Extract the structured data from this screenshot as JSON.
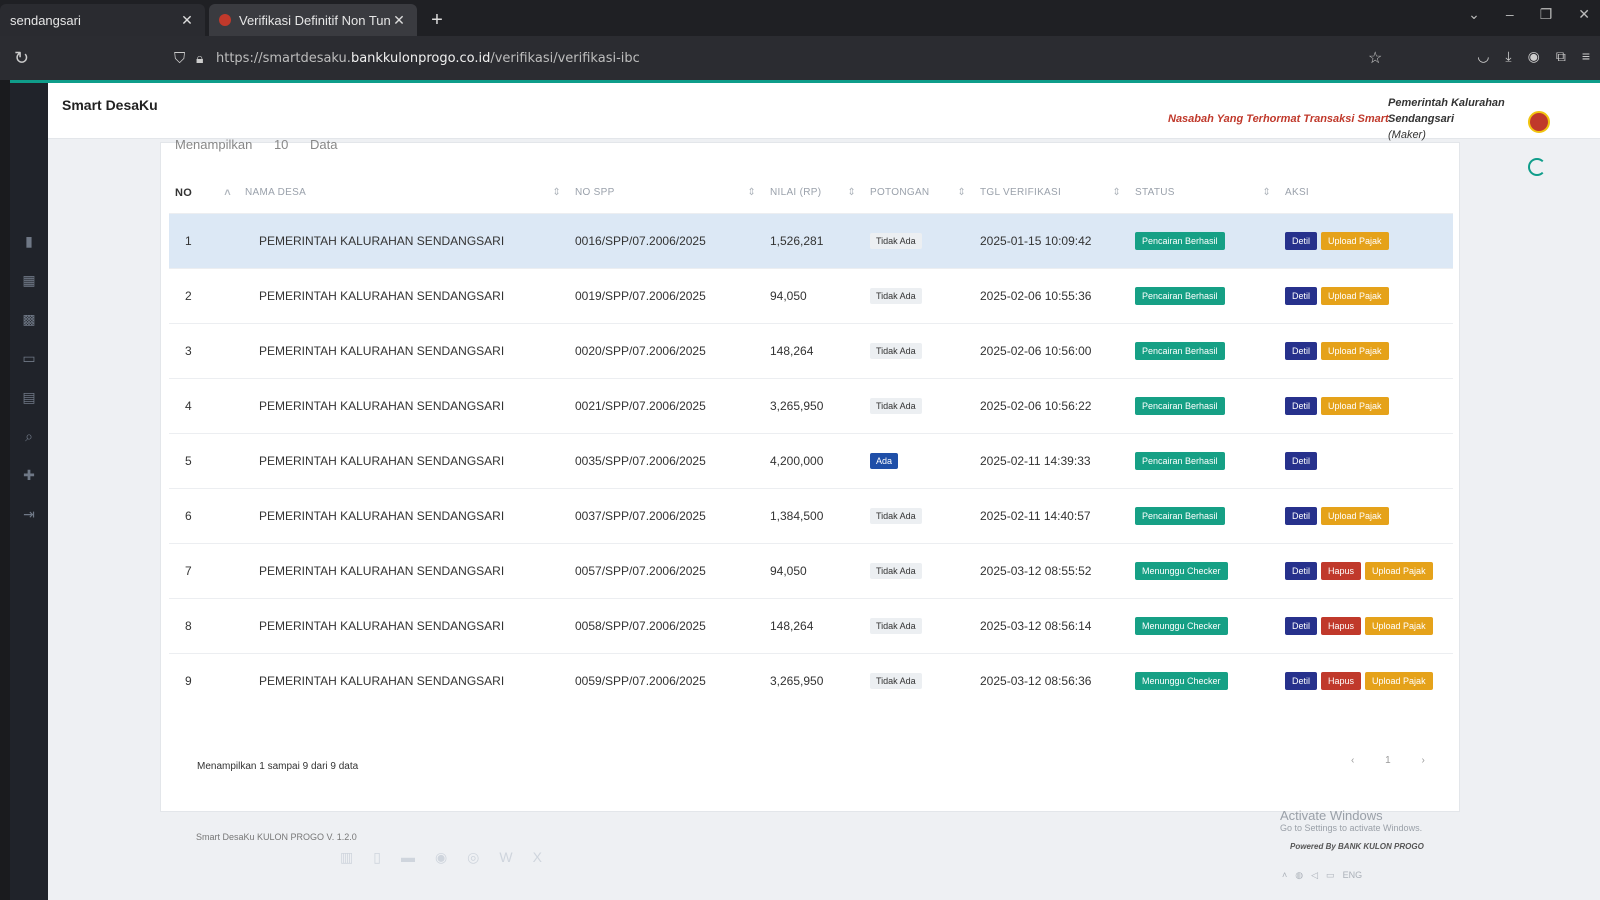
{
  "browser": {
    "tabs": [
      {
        "label": "sendangsari",
        "active": false
      },
      {
        "label": "Verifikasi Definitif Non Tunai - S",
        "active": true
      }
    ],
    "url_prefix": "https://smartdesaku.",
    "url_domain": "bankkulonprogo.co.id",
    "url_path": "/verifikasi/verifikasi-ibc"
  },
  "header": {
    "brand": "Smart DesaKu",
    "marquee": "Nasabah Yang Terhormat Transaksi Smart",
    "user_name_line1": "Pemerintah Kalurahan",
    "user_name_line2": "Sendangsari",
    "user_role": "(Maker)"
  },
  "table": {
    "top_label": "Menampilkan",
    "top_count": "10",
    "top_suffix": "Data",
    "columns": [
      "NO",
      "NAMA DESA",
      "NO SPP",
      "NILAI (RP)",
      "POTONGAN",
      "TGL VERIFIKASI",
      "STATUS",
      "AKSI"
    ],
    "rows": [
      {
        "no": "1",
        "desa": "PEMERINTAH KALURAHAN SENDANGSARI",
        "spp": "0016/SPP/07.2006/2025",
        "nilai": "1,526,281",
        "potongan": "Tidak Ada",
        "tgl": "2025-01-15 10:09:42",
        "status": "Pencairan Berhasil",
        "detil": "Detil",
        "hapus": "",
        "upload": "Upload Pajak"
      },
      {
        "no": "2",
        "desa": "PEMERINTAH KALURAHAN SENDANGSARI",
        "spp": "0019/SPP/07.2006/2025",
        "nilai": "94,050",
        "potongan": "Tidak Ada",
        "tgl": "2025-02-06 10:55:36",
        "status": "Pencairan Berhasil",
        "detil": "Detil",
        "hapus": "",
        "upload": "Upload Pajak"
      },
      {
        "no": "3",
        "desa": "PEMERINTAH KALURAHAN SENDANGSARI",
        "spp": "0020/SPP/07.2006/2025",
        "nilai": "148,264",
        "potongan": "Tidak Ada",
        "tgl": "2025-02-06 10:56:00",
        "status": "Pencairan Berhasil",
        "detil": "Detil",
        "hapus": "",
        "upload": "Upload Pajak"
      },
      {
        "no": "4",
        "desa": "PEMERINTAH KALURAHAN SENDANGSARI",
        "spp": "0021/SPP/07.2006/2025",
        "nilai": "3,265,950",
        "potongan": "Tidak Ada",
        "tgl": "2025-02-06 10:56:22",
        "status": "Pencairan Berhasil",
        "detil": "Detil",
        "hapus": "",
        "upload": "Upload Pajak"
      },
      {
        "no": "5",
        "desa": "PEMERINTAH KALURAHAN SENDANGSARI",
        "spp": "0035/SPP/07.2006/2025",
        "nilai": "4,200,000",
        "potongan": "Ada",
        "tgl": "2025-02-11 14:39:33",
        "status": "Pencairan Berhasil",
        "detil": "Detil",
        "hapus": "",
        "upload": ""
      },
      {
        "no": "6",
        "desa": "PEMERINTAH KALURAHAN SENDANGSARI",
        "spp": "0037/SPP/07.2006/2025",
        "nilai": "1,384,500",
        "potongan": "Tidak Ada",
        "tgl": "2025-02-11 14:40:57",
        "status": "Pencairan Berhasil",
        "detil": "Detil",
        "hapus": "",
        "upload": "Upload Pajak"
      },
      {
        "no": "7",
        "desa": "PEMERINTAH KALURAHAN SENDANGSARI",
        "spp": "0057/SPP/07.2006/2025",
        "nilai": "94,050",
        "potongan": "Tidak Ada",
        "tgl": "2025-03-12 08:55:52",
        "status": "Menunggu Checker",
        "detil": "Detil",
        "hapus": "Hapus",
        "upload": "Upload Pajak"
      },
      {
        "no": "8",
        "desa": "PEMERINTAH KALURAHAN SENDANGSARI",
        "spp": "0058/SPP/07.2006/2025",
        "nilai": "148,264",
        "potongan": "Tidak Ada",
        "tgl": "2025-03-12 08:56:14",
        "status": "Menunggu Checker",
        "detil": "Detil",
        "hapus": "Hapus",
        "upload": "Upload Pajak"
      },
      {
        "no": "9",
        "desa": "PEMERINTAH KALURAHAN SENDANGSARI",
        "spp": "0059/SPP/07.2006/2025",
        "nilai": "3,265,950",
        "potongan": "Tidak Ada",
        "tgl": "2025-03-12 08:56:36",
        "status": "Menunggu Checker",
        "detil": "Detil",
        "hapus": "Hapus",
        "upload": "Upload Pajak"
      }
    ],
    "showing_text": "Menampilkan 1 sampai 9 dari 9 data",
    "pager": "‹ 1 ›"
  },
  "os": {
    "activate_title": "Activate Windows",
    "activate_sub": "Go to Settings to activate Windows.",
    "powered_by": "Powered By BANK KULON PROGO",
    "tray_lang": "ENG"
  },
  "footer": "Smart DesaKu KULON PROGO V. 1.2.0",
  "colors": {
    "accent": "#0f9d8a",
    "detil": "#27318c",
    "hapus": "#c0392b",
    "upload": "#e5a21a",
    "status": "#16a085"
  }
}
